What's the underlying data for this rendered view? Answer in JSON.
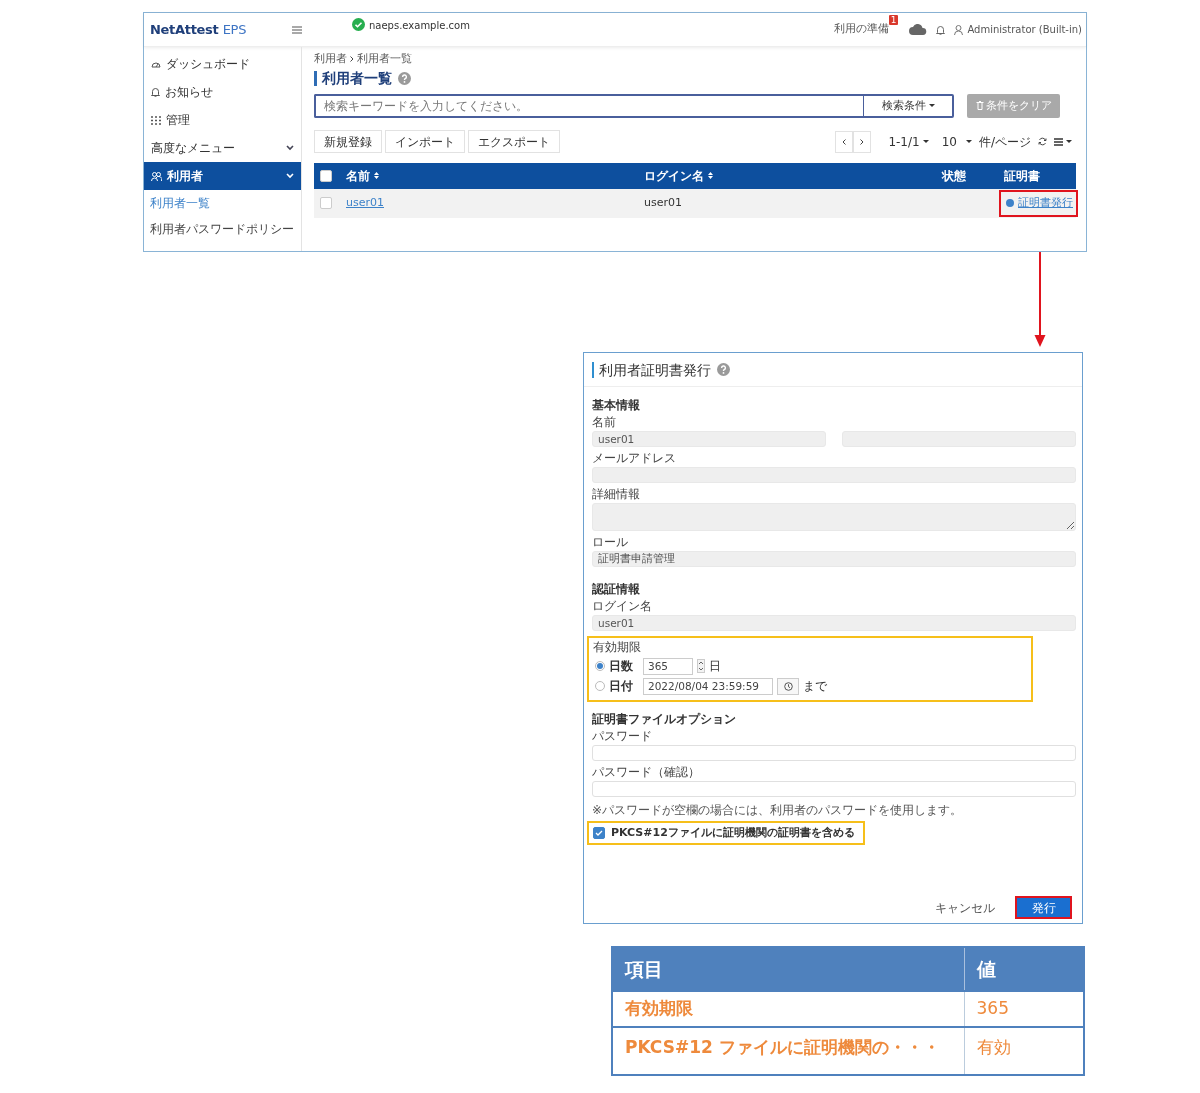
{
  "app": {
    "logo": {
      "brand": "NetAttest",
      "product": "EPS"
    },
    "host": "naeps.example.com",
    "host_ok": true,
    "prep": {
      "label": "利用の準備",
      "badge": "1"
    },
    "user": "Administrator (Built-in)"
  },
  "sidebar": {
    "items": [
      {
        "label": "ダッシュボード",
        "kind": "link",
        "selected": false
      },
      {
        "label": "お知らせ",
        "kind": "link",
        "selected": false
      },
      {
        "label": "管理",
        "kind": "link",
        "selected": false
      },
      {
        "label": "高度なメニュー",
        "kind": "group",
        "selected": false
      },
      {
        "label": "利用者",
        "kind": "group",
        "selected": true,
        "children": [
          {
            "label": "利用者一覧",
            "selected": true
          },
          {
            "label": "利用者パスワードポリシー",
            "selected": false
          }
        ]
      }
    ]
  },
  "main": {
    "breadcrumb": [
      "利用者",
      "利用者一覧"
    ],
    "title": "利用者一覧",
    "search": {
      "placeholder": "検索キーワードを入力してください。",
      "condition": "検索条件",
      "clear": "条件をクリア"
    },
    "actions": [
      "新規登録",
      "インポート",
      "エクスポート"
    ],
    "pager": {
      "range": "1-1/1",
      "per_page": "10",
      "per_page_unit": "件/ページ"
    },
    "table": {
      "select_all": {
        "checked": false
      },
      "columns": [
        {
          "label": "名前",
          "sortable": true
        },
        {
          "label": "ログイン名",
          "sortable": true
        },
        {
          "label": "状態",
          "sortable": false
        },
        {
          "label": "証明書",
          "sortable": false
        }
      ],
      "rows": [
        {
          "checked": false,
          "name": "user01",
          "login": "user01",
          "cert": "証明書発行",
          "callout": true
        }
      ]
    }
  },
  "dialog": {
    "title": "利用者証明書発行",
    "sections": [
      {
        "heading": "基本情報",
        "fields": [
          {
            "kind": "name",
            "label": "名前",
            "value": "user01"
          },
          {
            "kind": "text",
            "label": "メールアドレス"
          },
          {
            "kind": "textarea",
            "label": "詳細情報"
          },
          {
            "kind": "text",
            "label": "ロール",
            "value": "証明書申請管理"
          }
        ]
      },
      {
        "heading": "認証情報",
        "fields": [
          {
            "kind": "text",
            "label": "ログイン名",
            "value": "user01"
          },
          {
            "kind": "validity",
            "label": "有効期限",
            "callout": true,
            "options": [
              {
                "label": "日数",
                "selected": true,
                "value": "365",
                "unit": "日"
              },
              {
                "label": "日付",
                "selected": false,
                "value": "2022/08/04 23:59:59",
                "unit": "まで"
              }
            ]
          }
        ]
      },
      {
        "heading": "証明書ファイルオプション",
        "fields": [
          {
            "kind": "text",
            "label": "パスワード"
          },
          {
            "kind": "text",
            "label": "パスワード（確認）"
          },
          {
            "kind": "note",
            "label": "※パスワードが空欄の場合には、利用者のパスワードを使用します。"
          },
          {
            "kind": "checkbox",
            "label": "PKCS#12ファイルに証明機関の証明書を含める",
            "checked": true,
            "callout": true
          }
        ]
      }
    ],
    "cancel": "キャンセル",
    "submit": {
      "label": "発行",
      "callout": true
    }
  },
  "summary": {
    "columns": [
      "項目",
      "値"
    ],
    "rows": [
      [
        "有効期限",
        "365"
      ],
      [
        "PKCS#12 ファイルに証明機関の・・・",
        "有効"
      ]
    ]
  }
}
